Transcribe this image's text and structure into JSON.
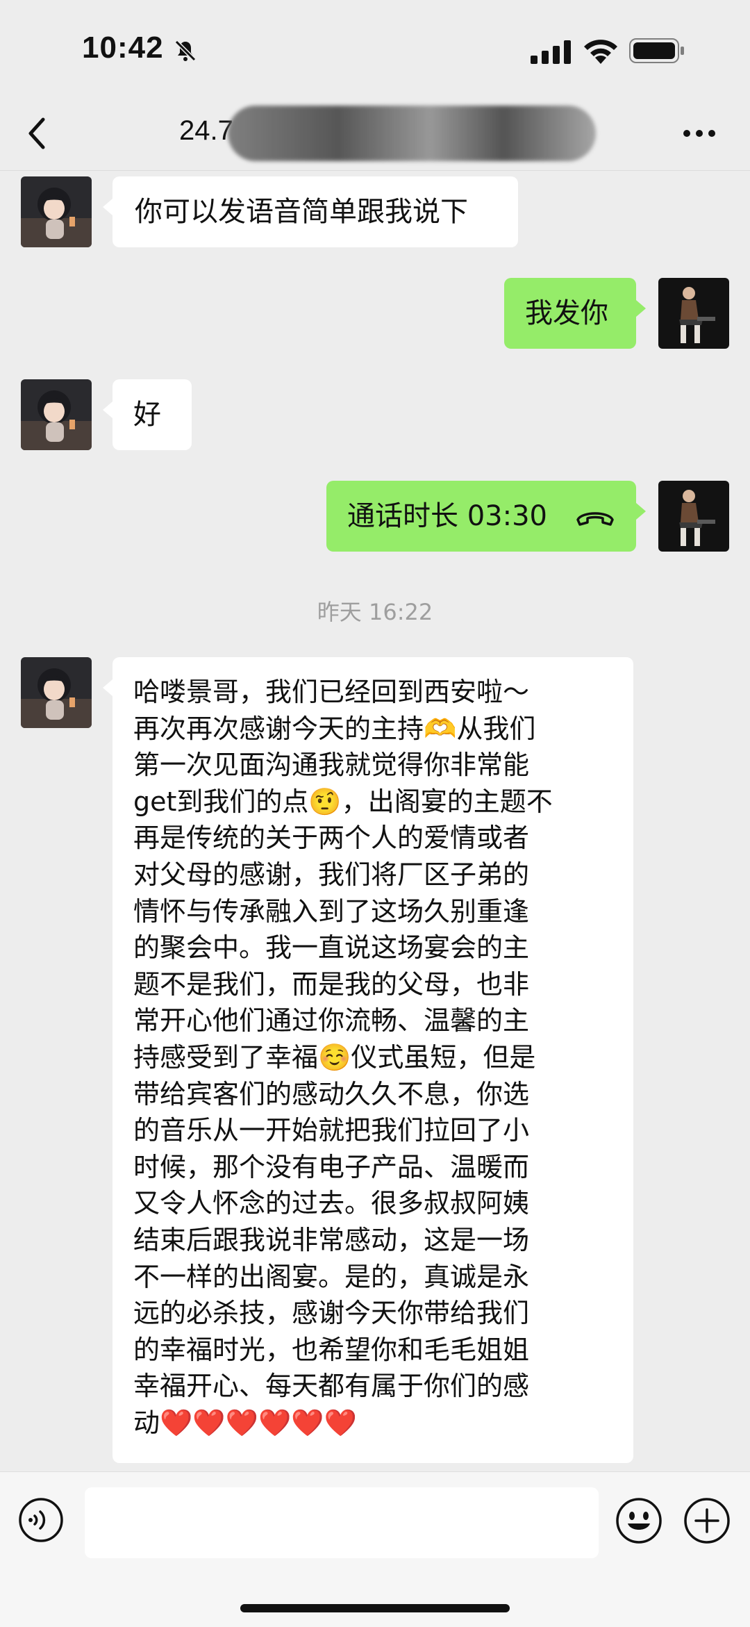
{
  "status_bar": {
    "time": "10:42"
  },
  "nav": {
    "title": "24.7"
  },
  "messages": [
    {
      "side": "left",
      "text": "你可以发语音简单跟我说下"
    },
    {
      "side": "right",
      "text": "我发你"
    },
    {
      "side": "left",
      "text": "好"
    },
    {
      "side": "right",
      "call_text": "通话时长 03:30"
    }
  ],
  "timestamp": "昨天 16:22",
  "long_message": {
    "lines": [
      "哈喽景哥，我们已经回到西安啦～",
      "再次再次感谢今天的主持🫶从我们",
      "第一次见面沟通我就觉得你非常能",
      "get到我们的点🤨，出阁宴的主题不",
      "再是传统的关于两个人的爱情或者",
      "对父母的感谢，我们将厂区子弟的",
      "情怀与传承融入到了这场久别重逢",
      "的聚会中。我一直说这场宴会的主",
      "题不是我们，而是我的父母，也非",
      "常开心他们通过你流畅、温馨的主",
      "持感受到了幸福☺️仪式虽短，但是",
      "带给宾客们的感动久久不息，你选",
      "的音乐从一开始就把我们拉回了小",
      "时候，那个没有电子产品、温暖而",
      "又令人怀念的过去。很多叔叔阿姨",
      "结束后跟我说非常感动，这是一场",
      "不一样的出阁宴。是的，真诚是永",
      "远的必杀技，感谢今天你带给我们",
      "的幸福时光，也希望你和毛毛姐姐",
      "幸福开心、每天都有属于你们的感",
      "动❤️❤️❤️❤️❤️❤️"
    ]
  },
  "input": {
    "value": ""
  },
  "icons": {
    "back": "chevron-left-icon",
    "more": "more-dots-icon",
    "voice": "voice-icon",
    "emoji": "emoji-icon",
    "plus": "plus-icon",
    "call": "phone-hangup-icon"
  }
}
